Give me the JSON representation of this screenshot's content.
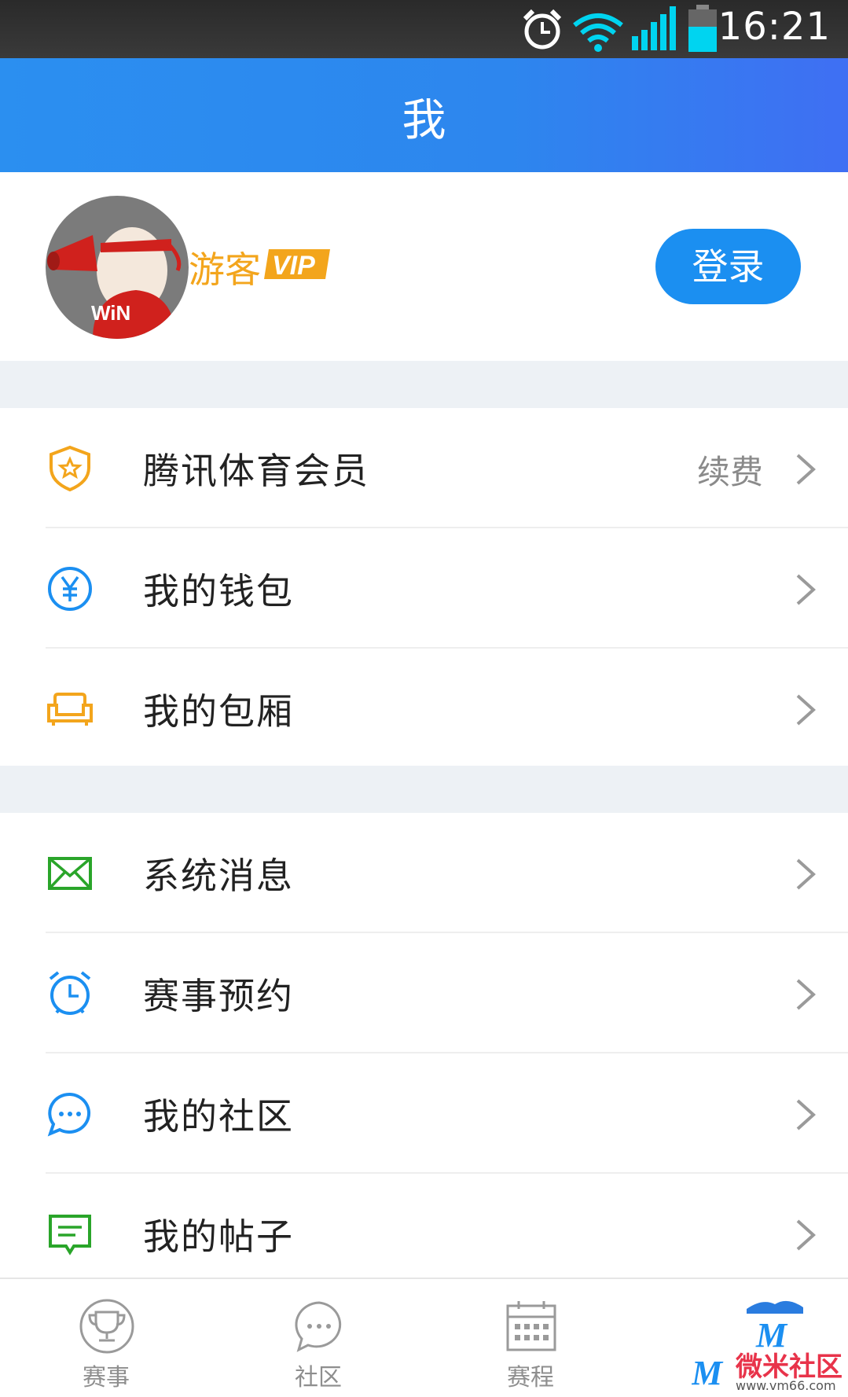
{
  "status_bar": {
    "time": "16:21"
  },
  "header": {
    "title": "我"
  },
  "profile": {
    "username": "游客",
    "vip_text": "VIP",
    "avatar_text": "WiN",
    "login_label": "登录"
  },
  "menu_section_1": [
    {
      "label": "腾讯体育会员",
      "extra": "续费",
      "icon": "shield-star-icon",
      "color": "#f3a51c"
    },
    {
      "label": "我的钱包",
      "extra": "",
      "icon": "yuan-icon",
      "color": "#1b8ff1"
    },
    {
      "label": "我的包厢",
      "extra": "",
      "icon": "sofa-icon",
      "color": "#f3a51c"
    }
  ],
  "menu_section_2": [
    {
      "label": "系统消息",
      "icon": "mail-icon",
      "color": "#2aa52a"
    },
    {
      "label": "赛事预约",
      "icon": "alarm-clock-icon",
      "color": "#1b8ff1"
    },
    {
      "label": "我的社区",
      "icon": "chat-bubble-icon",
      "color": "#1b8ff1"
    },
    {
      "label": "我的帖子",
      "icon": "message-lines-icon",
      "color": "#2aa52a"
    }
  ],
  "tabbar": [
    {
      "label": "赛事",
      "icon": "trophy-icon"
    },
    {
      "label": "社区",
      "icon": "chat-icon"
    },
    {
      "label": "赛程",
      "icon": "calendar-icon"
    },
    {
      "label": "",
      "icon": "me-icon"
    }
  ],
  "watermark": {
    "text": "微米社区",
    "url": "www.vm66.com"
  }
}
